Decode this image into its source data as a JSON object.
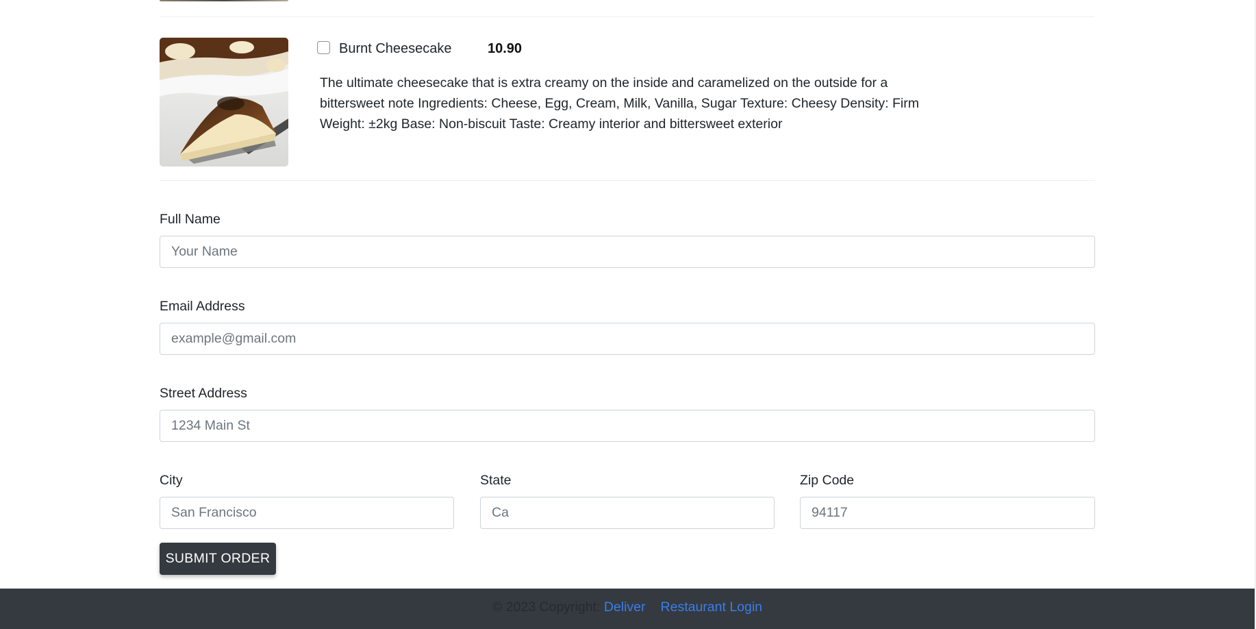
{
  "item": {
    "name": "Burnt Cheesecake",
    "price": "10.90",
    "checked": false,
    "description": "The ultimate cheesecake that is extra creamy on the inside and caramelized on the outside for a bittersweet note Ingredients: Cheese, Egg, Cream, Milk, Vanilla, Sugar Texture: Cheesy Density: Firm Weight: ±2kg Base: Non-biscuit Taste: Creamy interior and bittersweet exterior"
  },
  "form": {
    "full_name": {
      "label": "Full Name",
      "placeholder": "Your Name",
      "value": ""
    },
    "email": {
      "label": "Email Address",
      "placeholder": "example@gmail.com",
      "value": ""
    },
    "street": {
      "label": "Street Address",
      "placeholder": "1234 Main St",
      "value": ""
    },
    "city": {
      "label": "City",
      "placeholder": "San Francisco",
      "value": ""
    },
    "state": {
      "label": "State",
      "placeholder": "Ca",
      "value": ""
    },
    "zip": {
      "label": "Zip Code",
      "placeholder": "94117",
      "value": ""
    },
    "submit_label": "SUBMIT ORDER"
  },
  "footer": {
    "copyright": "© 2023 Copyright:",
    "brand_link": "Deliver",
    "login_link": "Restaurant Login"
  },
  "colors": {
    "footer_bg": "#343a40",
    "button_bg": "#343a40",
    "link": "#3b7dea"
  }
}
